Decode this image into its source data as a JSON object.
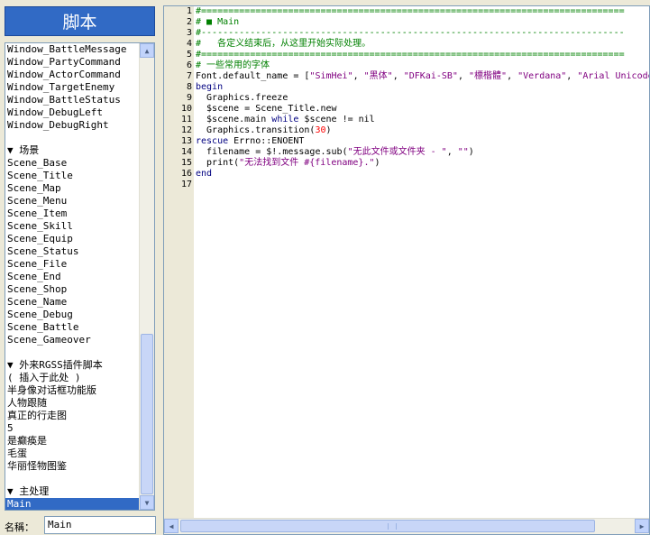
{
  "panel": {
    "title": "脚本"
  },
  "script_list": [
    "Window_BattleMessage",
    "Window_PartyCommand",
    "Window_ActorCommand",
    "Window_TargetEnemy",
    "Window_BattleStatus",
    "Window_DebugLeft",
    "Window_DebugRight",
    "",
    "▼ 场景",
    "Scene_Base",
    "Scene_Title",
    "Scene_Map",
    "Scene_Menu",
    "Scene_Item",
    "Scene_Skill",
    "Scene_Equip",
    "Scene_Status",
    "Scene_File",
    "Scene_End",
    "Scene_Shop",
    "Scene_Name",
    "Scene_Debug",
    "Scene_Battle",
    "Scene_Gameover",
    "",
    "▼ 外来RGSS插件脚本",
    "( 插入于此处 )",
    "半身像对话框功能版",
    "人物跟随",
    "真正的行走图",
    "5",
    "是癫痪是",
    "毛蛋",
    "华丽怪物图鉴",
    "",
    "▼ 主处理",
    "Main"
  ],
  "selected_script": "Main",
  "name_field": {
    "label": "名稱：",
    "value": "Main"
  },
  "editor": {
    "line_numbers": [
      "1",
      "2",
      "3",
      "4",
      "5",
      "6",
      "7",
      "8",
      "9",
      "10",
      "11",
      "12",
      "13",
      "14",
      "15",
      "16",
      "17"
    ]
  },
  "colors": {
    "title_bg": "#316ac5",
    "selection_bg": "#316ac5",
    "comment": "#008000",
    "string": "#800080",
    "number": "#ff0000"
  }
}
